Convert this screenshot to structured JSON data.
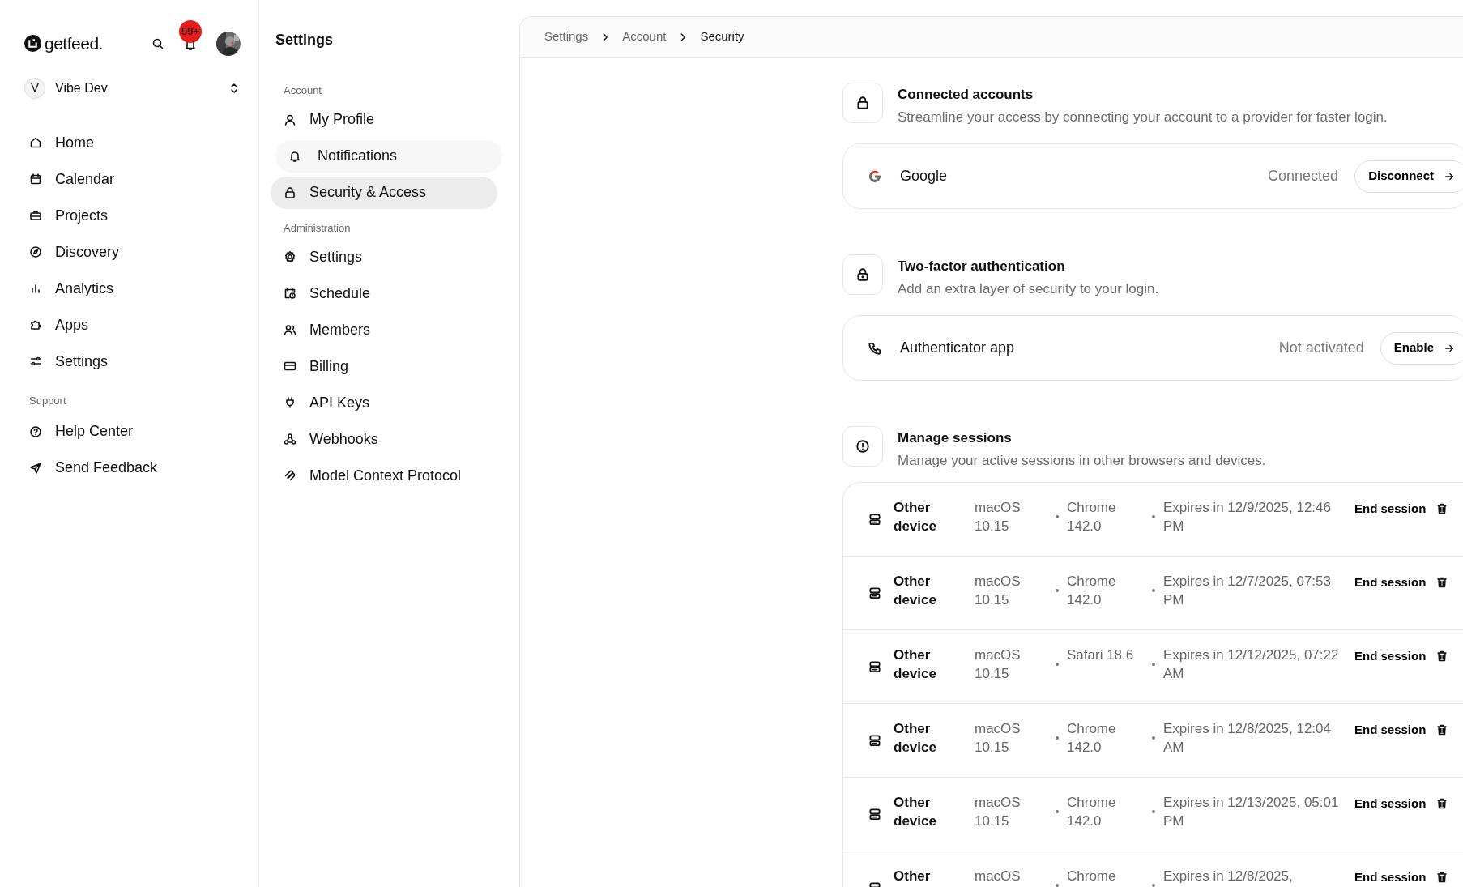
{
  "sidebar": {
    "logo": "getfeed.",
    "notification_badge": "99+",
    "workspace": {
      "initial": "V",
      "name": "Vibe Dev"
    },
    "sections": [
      {
        "items": [
          {
            "label": "Home"
          },
          {
            "label": "Calendar"
          },
          {
            "label": "Projects"
          },
          {
            "label": "Discovery"
          },
          {
            "label": "Analytics"
          },
          {
            "label": "Apps"
          },
          {
            "label": "Settings"
          }
        ]
      },
      {
        "title": "Support",
        "items": [
          {
            "label": "Help Center"
          },
          {
            "label": "Send Feedback"
          }
        ]
      }
    ]
  },
  "settings_nav": {
    "title": "Settings",
    "groups": [
      {
        "title": "Account",
        "items": [
          {
            "label": "My Profile",
            "selected": false,
            "hovered": false
          },
          {
            "label": "Notifications",
            "selected": false,
            "hovered": true
          },
          {
            "label": "Security & Access",
            "selected": true,
            "hovered": false
          }
        ]
      },
      {
        "title": "Administration",
        "items": [
          {
            "label": "Settings",
            "selected": false,
            "hovered": false
          },
          {
            "label": "Schedule",
            "selected": false,
            "hovered": false
          },
          {
            "label": "Members",
            "selected": false,
            "hovered": false
          },
          {
            "label": "Billing",
            "selected": false,
            "hovered": false
          },
          {
            "label": "API Keys",
            "selected": false,
            "hovered": false
          },
          {
            "label": "Webhooks",
            "selected": false,
            "hovered": false
          },
          {
            "label": "Model Context Protocol",
            "selected": false,
            "hovered": false
          }
        ]
      }
    ]
  },
  "breadcrumb": [
    "Settings",
    "Account",
    "Security"
  ],
  "sections": [
    {
      "kind": "accounts",
      "title": "Connected accounts",
      "description": "Streamline your access by connecting your account to a provider for faster login.",
      "items": [
        {
          "name": "Google",
          "status": "Connected",
          "action": "Disconnect"
        }
      ]
    },
    {
      "kind": "twofactor",
      "title": "Two-factor authentication",
      "description": "Add an extra layer of security to your login.",
      "items": [
        {
          "name": "Authenticator app",
          "status": "Not activated",
          "action": "Enable"
        }
      ]
    },
    {
      "kind": "sessions",
      "title": "Manage sessions",
      "description": "Manage your active sessions in other browsers and devices.",
      "rows": [
        {
          "device": "Other device",
          "os": "macOS 10.15",
          "browser": "Chrome 142.0",
          "expires": "Expires in 12/9/2025, 12:46 PM",
          "action": "End session"
        },
        {
          "device": "Other device",
          "os": "macOS 10.15",
          "browser": "Chrome 142.0",
          "expires": "Expires in 12/7/2025, 07:53 PM",
          "action": "End session"
        },
        {
          "device": "Other device",
          "os": "macOS 10.15",
          "browser": "Safari 18.6",
          "expires": "Expires in 12/12/2025, 07:22 AM",
          "action": "End session"
        },
        {
          "device": "Other device",
          "os": "macOS 10.15",
          "browser": "Chrome 142.0",
          "expires": "Expires in 12/8/2025, 12:04 AM",
          "action": "End session"
        },
        {
          "device": "Other device",
          "os": "macOS 10.15",
          "browser": "Chrome 142.0",
          "expires": "Expires in 12/13/2025, 05:01 PM",
          "action": "End session"
        },
        {
          "device": "Other",
          "os": "macOS",
          "browser": "Chrome",
          "expires": "Expires in 12/8/2025,",
          "action": "End session"
        }
      ]
    }
  ]
}
